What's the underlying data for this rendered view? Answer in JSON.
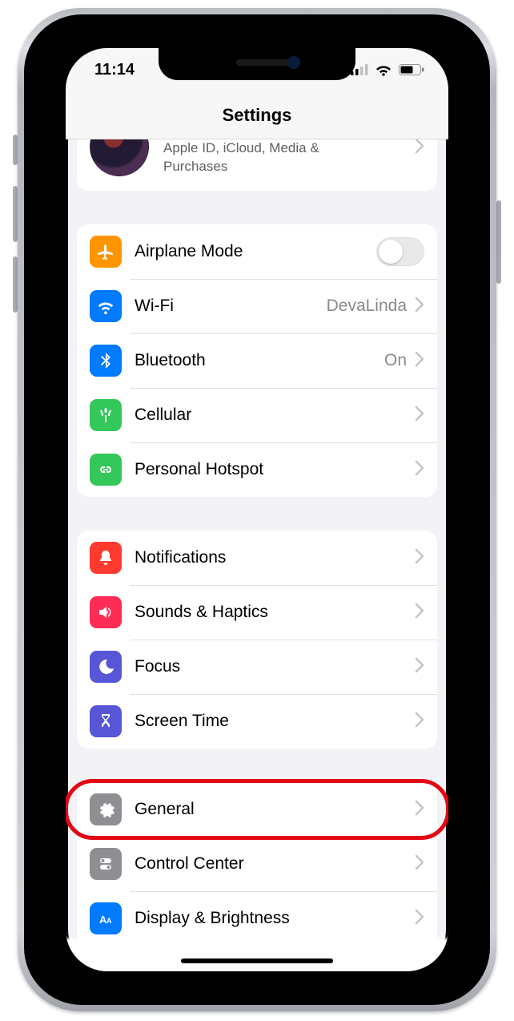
{
  "status": {
    "time": "11:14"
  },
  "header": {
    "title": "Settings"
  },
  "profile": {
    "subtitle": "Apple ID, iCloud, Media & Purchases"
  },
  "group_network": {
    "airplane": {
      "label": "Airplane Mode",
      "on": false
    },
    "wifi": {
      "label": "Wi-Fi",
      "value": "DevaLinda"
    },
    "bluetooth": {
      "label": "Bluetooth",
      "value": "On"
    },
    "cellular": {
      "label": "Cellular"
    },
    "hotspot": {
      "label": "Personal Hotspot"
    }
  },
  "group_alerts": {
    "notifications": {
      "label": "Notifications"
    },
    "sounds": {
      "label": "Sounds & Haptics"
    },
    "focus": {
      "label": "Focus"
    },
    "screentime": {
      "label": "Screen Time"
    }
  },
  "group_system": {
    "general": {
      "label": "General"
    },
    "controlcenter": {
      "label": "Control Center"
    },
    "display": {
      "label": "Display & Brightness"
    }
  },
  "highlight_target": "general"
}
